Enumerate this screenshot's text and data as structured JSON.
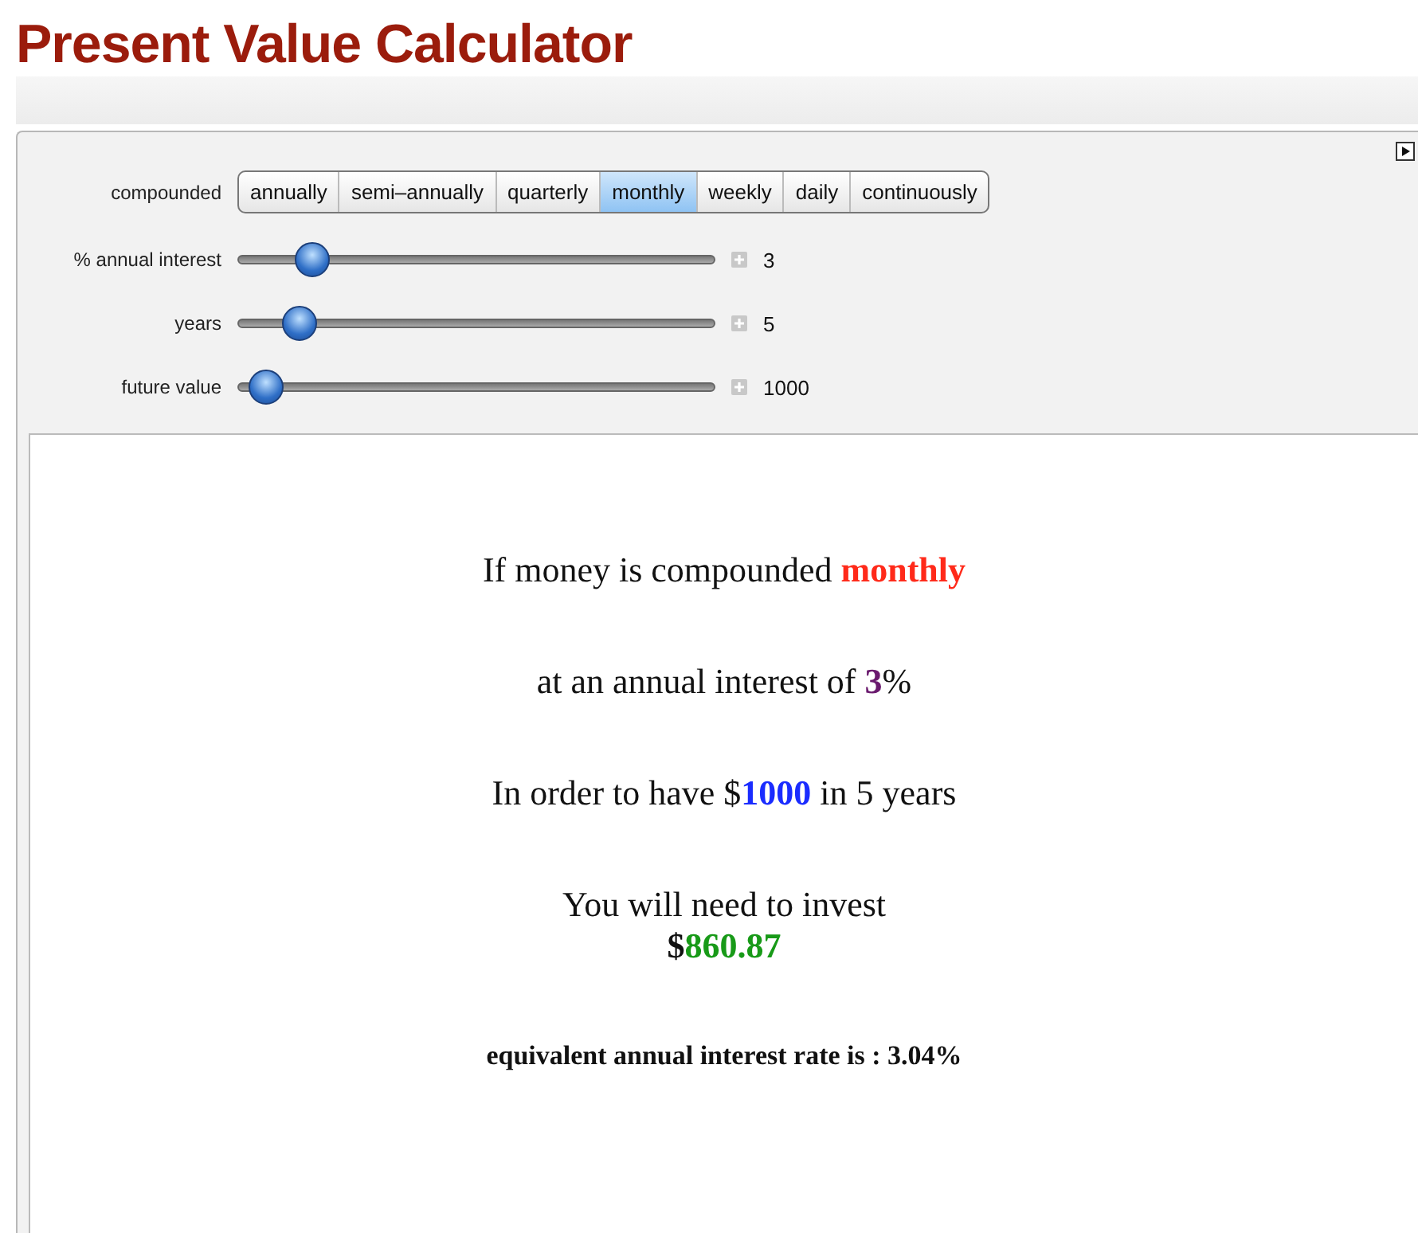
{
  "title": "Present Value Calculator",
  "compounded": {
    "label": "compounded",
    "options": [
      {
        "label": "annually",
        "selected": false
      },
      {
        "label": "semi–annually",
        "selected": false
      },
      {
        "label": "quarterly",
        "selected": false
      },
      {
        "label": "monthly",
        "selected": true
      },
      {
        "label": "weekly",
        "selected": false
      },
      {
        "label": "daily",
        "selected": false
      },
      {
        "label": "continuously",
        "selected": false
      }
    ]
  },
  "sliders": [
    {
      "label": "% annual interest",
      "level": 0.13,
      "reading": "3"
    },
    {
      "label": "years",
      "level": 0.1,
      "reading": "5"
    },
    {
      "label": "future value",
      "level": 0.025,
      "reading": "1000"
    }
  ],
  "output": [
    {
      "kind": "sentence",
      "parts": [
        {
          "text": "If money is compounded "
        },
        {
          "text": "monthly",
          "color": "#ff2a1a"
        }
      ]
    },
    {
      "kind": "sentence",
      "parts": [
        {
          "text": "at an annual interest of  "
        },
        {
          "text": "3",
          "color": "#6a1a6e"
        },
        {
          "text": "%"
        }
      ]
    },
    {
      "kind": "sentence",
      "parts": [
        {
          "text": "In order to have $"
        },
        {
          "text": "1000",
          "color": "#1a2cff"
        },
        {
          "text": " in 5 years"
        }
      ]
    },
    {
      "kind": "result",
      "parts": [
        {
          "text": "You will need to invest"
        }
      ]
    },
    {
      "kind": "amount",
      "parts": [
        {
          "text": "$"
        },
        {
          "text": "860.87",
          "color": "#189a18"
        }
      ]
    },
    {
      "kind": "note",
      "parts": [
        {
          "text": "equivalent annual interest rate is : 3.04%"
        }
      ]
    }
  ]
}
